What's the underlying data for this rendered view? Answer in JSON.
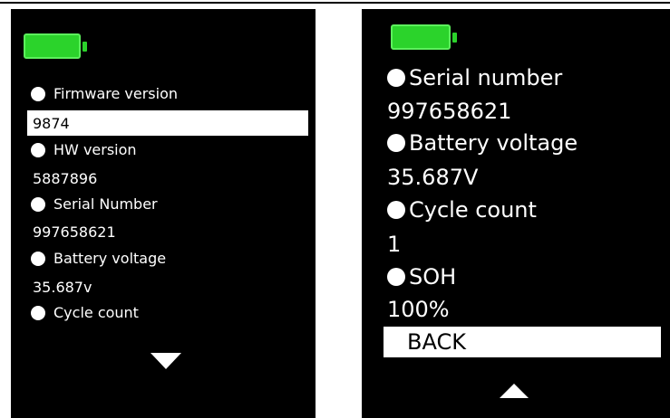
{
  "colors": {
    "screen_background": "#000000",
    "text": "#ffffff",
    "battery_fill": "#2bd32b",
    "highlight": "#ffffff"
  },
  "left_screen": {
    "battery_icon": "battery-full-icon",
    "firmware": {
      "label": "Firmware version",
      "value": "9874"
    },
    "hw": {
      "label": "HW version",
      "value": "5887896"
    },
    "serial": {
      "label": "Serial Number",
      "value": "997658621"
    },
    "voltage": {
      "label": "Battery voltage",
      "value": "35.687v"
    },
    "cycle": {
      "label": "Cycle count"
    },
    "scroll_icon": "arrow-down-icon"
  },
  "right_screen": {
    "battery_icon": "battery-full-icon",
    "serial": {
      "label": "Serial number",
      "value": "997658621"
    },
    "voltage": {
      "label": "Battery voltage",
      "value": "35.687V"
    },
    "cycle": {
      "label": "Cycle count",
      "value": "1"
    },
    "soh": {
      "label": "SOH",
      "value": "100%"
    },
    "back_label": "BACK",
    "scroll_icon": "arrow-up-icon"
  }
}
